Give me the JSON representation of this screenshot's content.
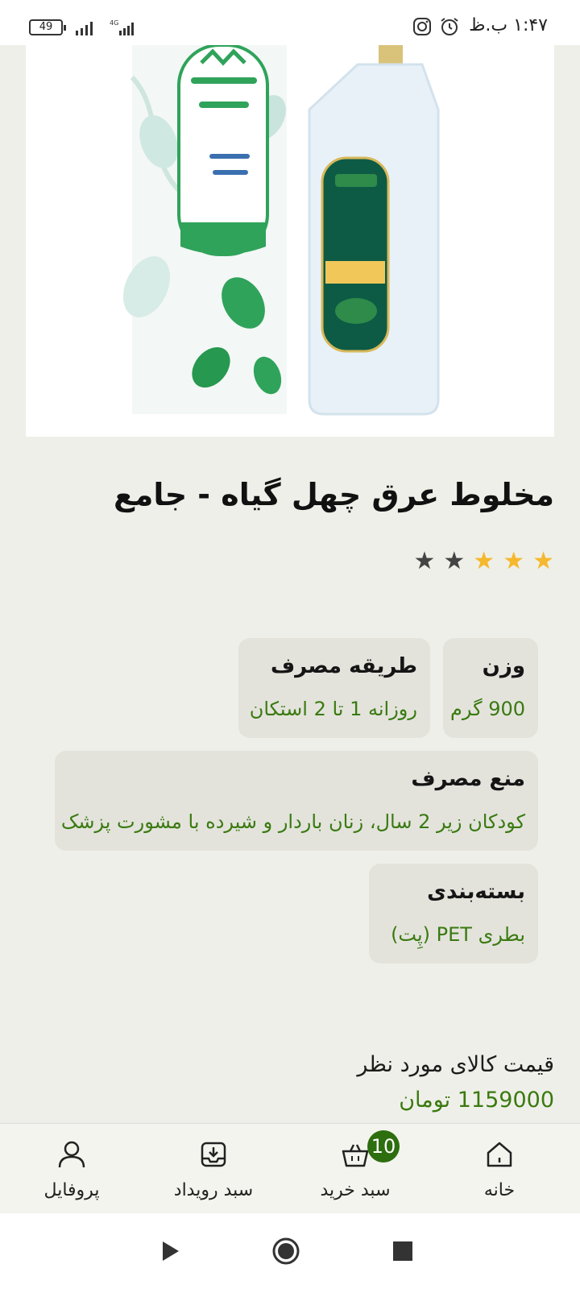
{
  "status_bar": {
    "time": "۱:۴۷ ب.ظ",
    "battery": "49",
    "network": "4G",
    "icons": [
      "instagram-icon",
      "alarm-icon",
      "signal-icon",
      "battery-icon"
    ]
  },
  "product": {
    "title": "مخلوط عرق چهل گیاه - جامع",
    "rating": 3,
    "rating_max": 5,
    "image_count": 2,
    "active_image_index": 1
  },
  "specs": {
    "weight": {
      "title": "وزن",
      "value": "900 گرم"
    },
    "usage": {
      "title": "طریقه مصرف",
      "value": "روزانه 1 تا 2 استکان"
    },
    "contraindication": {
      "title": "منع مصرف",
      "value": "کودکان زیر 2 سال، زنان باردار و شیرده با مشورت پزشک"
    },
    "packaging": {
      "title": "بسته‌بندی",
      "value": "بطری PET (پِت)"
    }
  },
  "price": {
    "label": "قیمت کالای مورد نظر",
    "value": "1159000 تومان"
  },
  "bottom_nav": {
    "home": "خانه",
    "cart": "سبد خرید",
    "cart_count": "10",
    "events": "سبد رویداد",
    "profile": "پروفایل"
  },
  "colors": {
    "accent": "#2d6e0f",
    "star_filled": "#f5b82e",
    "star_empty": "#444444",
    "background": "#efefe9",
    "card": "#e3e3dc"
  }
}
